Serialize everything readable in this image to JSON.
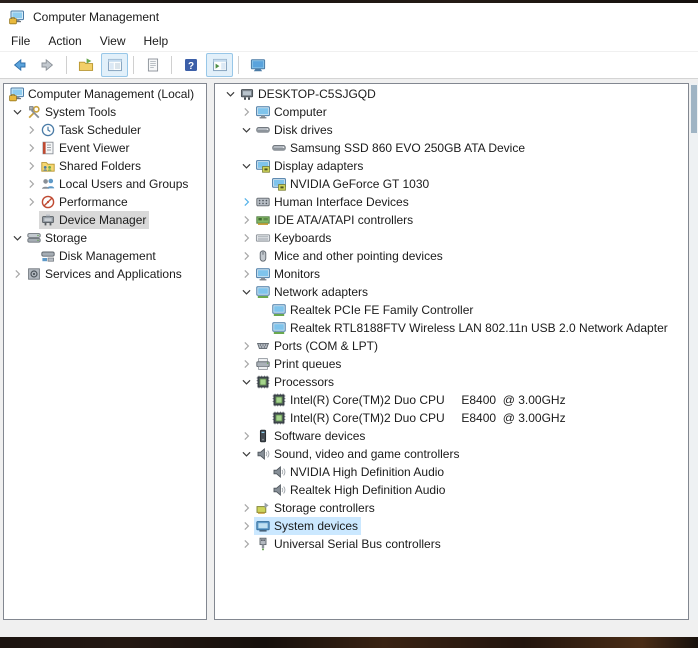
{
  "window": {
    "title": "Computer Management",
    "title_icon": "computer-management"
  },
  "menu_bar": {
    "items": [
      {
        "label": "File"
      },
      {
        "label": "Action"
      },
      {
        "label": "View"
      },
      {
        "label": "Help"
      }
    ]
  },
  "toolbar": {
    "buttons": [
      {
        "icon": "back-arrow",
        "pressed": false
      },
      {
        "icon": "forward-arrow",
        "pressed": false
      },
      {
        "separator": true
      },
      {
        "icon": "export-list",
        "pressed": false
      },
      {
        "icon": "show-console-tree",
        "pressed": true
      },
      {
        "separator": true
      },
      {
        "icon": "properties",
        "pressed": false
      },
      {
        "separator": true
      },
      {
        "icon": "help",
        "pressed": false
      },
      {
        "icon": "show-action-pane",
        "pressed": true
      },
      {
        "separator": true
      },
      {
        "icon": "remote-control",
        "pressed": false
      }
    ]
  },
  "left_tree": {
    "items": [
      {
        "label": "Computer Management (Local)",
        "icon": "computer-management",
        "level": 0,
        "chevron": "omit"
      },
      {
        "label": "System Tools",
        "icon": "system-tools",
        "level": 1,
        "chevron": "expanded"
      },
      {
        "label": "Task Scheduler",
        "icon": "task-scheduler",
        "level": 2,
        "chevron": "collapsed"
      },
      {
        "label": "Event Viewer",
        "icon": "event-viewer",
        "level": 2,
        "chevron": "collapsed"
      },
      {
        "label": "Shared Folders",
        "icon": "shared-folders",
        "level": 2,
        "chevron": "collapsed"
      },
      {
        "label": "Local Users and Groups",
        "icon": "users-groups",
        "level": 2,
        "chevron": "collapsed"
      },
      {
        "label": "Performance",
        "icon": "performance",
        "level": 2,
        "chevron": "collapsed"
      },
      {
        "label": "Device Manager",
        "icon": "device-manager",
        "level": 2,
        "chevron": "blank",
        "selected": "inactive"
      },
      {
        "label": "Storage",
        "icon": "storage",
        "level": 1,
        "chevron": "expanded"
      },
      {
        "label": "Disk Management",
        "icon": "disk-management",
        "level": 2,
        "chevron": "blank"
      },
      {
        "label": "Services and Applications",
        "icon": "services-applications",
        "level": 1,
        "chevron": "collapsed"
      }
    ]
  },
  "right_tree": {
    "items": [
      {
        "label": "DESKTOP-C5SJGQD",
        "icon": "desktop-pc",
        "level": 0,
        "chevron": "expanded"
      },
      {
        "label": "Computer",
        "icon": "computer-monitor",
        "level": 1,
        "chevron": "collapsed"
      },
      {
        "label": "Disk drives",
        "icon": "disk-drive",
        "level": 1,
        "chevron": "expanded"
      },
      {
        "label": "Samsung SSD 860 EVO 250GB ATA Device",
        "icon": "disk-drive",
        "level": 2,
        "chevron": "blank"
      },
      {
        "label": "Display adapters",
        "icon": "display-adapter",
        "level": 1,
        "chevron": "expanded"
      },
      {
        "label": "NVIDIA GeForce GT 1030",
        "icon": "display-adapter",
        "level": 2,
        "chevron": "blank"
      },
      {
        "label": "Human Interface Devices",
        "icon": "hid-device",
        "level": 1,
        "chevron": "collapsed-hover"
      },
      {
        "label": "IDE ATA/ATAPI controllers",
        "icon": "ide-controller",
        "level": 1,
        "chevron": "collapsed"
      },
      {
        "label": "Keyboards",
        "icon": "keyboard",
        "level": 1,
        "chevron": "collapsed"
      },
      {
        "label": "Mice and other pointing devices",
        "icon": "mouse",
        "level": 1,
        "chevron": "collapsed"
      },
      {
        "label": "Monitors",
        "icon": "computer-monitor",
        "level": 1,
        "chevron": "collapsed"
      },
      {
        "label": "Network adapters",
        "icon": "network-adapter",
        "level": 1,
        "chevron": "expanded"
      },
      {
        "label": "Realtek PCIe FE Family Controller",
        "icon": "network-adapter",
        "level": 2,
        "chevron": "blank"
      },
      {
        "label": "Realtek RTL8188FTV Wireless LAN 802.11n USB 2.0 Network Adapter",
        "icon": "network-adapter",
        "level": 2,
        "chevron": "blank"
      },
      {
        "label": "Ports (COM & LPT)",
        "icon": "serial-port",
        "level": 1,
        "chevron": "collapsed"
      },
      {
        "label": "Print queues",
        "icon": "printer",
        "level": 1,
        "chevron": "collapsed"
      },
      {
        "label": "Processors",
        "icon": "processor",
        "level": 1,
        "chevron": "expanded"
      },
      {
        "label": "Intel(R) Core(TM)2 Duo CPU     E8400  @ 3.00GHz",
        "icon": "processor",
        "level": 2,
        "chevron": "blank"
      },
      {
        "label": "Intel(R) Core(TM)2 Duo CPU     E8400  @ 3.00GHz",
        "icon": "processor",
        "level": 2,
        "chevron": "blank"
      },
      {
        "label": "Software devices",
        "icon": "software-device",
        "level": 1,
        "chevron": "collapsed"
      },
      {
        "label": "Sound, video and game controllers",
        "icon": "speaker",
        "level": 1,
        "chevron": "expanded"
      },
      {
        "label": "NVIDIA High Definition Audio",
        "icon": "speaker",
        "level": 2,
        "chevron": "blank"
      },
      {
        "label": "Realtek High Definition Audio",
        "icon": "speaker",
        "level": 2,
        "chevron": "blank"
      },
      {
        "label": "Storage controllers",
        "icon": "storage-controller",
        "level": 1,
        "chevron": "collapsed"
      },
      {
        "label": "System devices",
        "icon": "system-devices",
        "level": 1,
        "chevron": "collapsed",
        "selected": "active"
      },
      {
        "label": "Universal Serial Bus controllers",
        "icon": "usb-controller",
        "level": 1,
        "chevron": "collapsed"
      }
    ]
  },
  "colors": {
    "selection_active_bg": "#cbe8ff",
    "selection_inactive_bg": "#d9d9d9",
    "content_bg": "#f0f0f0",
    "panel_border": "#828790",
    "toolbar_pressed_bg": "#e2f0fa"
  }
}
